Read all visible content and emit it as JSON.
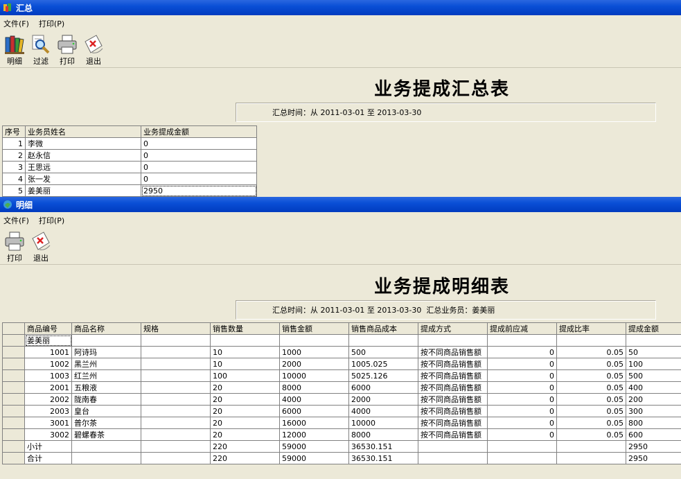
{
  "summary_window": {
    "title": "汇总",
    "menu": [
      "文件(F)",
      "打印(P)"
    ],
    "toolbar": [
      {
        "label": "明细",
        "icon": "books-icon"
      },
      {
        "label": "过滤",
        "icon": "filter-magnifier-icon"
      },
      {
        "label": "打印",
        "icon": "printer-icon"
      },
      {
        "label": "退出",
        "icon": "exit-icon"
      }
    ],
    "report_title": "业务提成汇总表",
    "info": "汇总时间：从 2011-03-01 至 2013-03-30",
    "table": {
      "headers": [
        "序号",
        "业务员姓名",
        "业务提成金额"
      ],
      "rows": [
        [
          "1",
          "李微",
          "0"
        ],
        [
          "2",
          "赵永信",
          "0"
        ],
        [
          "3",
          "王思远",
          "0"
        ],
        [
          "4",
          "张一发",
          "0"
        ],
        [
          "5",
          "姜美丽",
          "2950"
        ]
      ]
    }
  },
  "detail_window": {
    "title": "明细",
    "menu": [
      "文件(F)",
      "打印(P)"
    ],
    "toolbar": [
      {
        "label": "打印",
        "icon": "printer-icon"
      },
      {
        "label": "退出",
        "icon": "exit-icon"
      }
    ],
    "report_title": "业务提成明细表",
    "info": "汇总时间：从 2011-03-01 至 2013-03-30  汇总业务员：姜美丽",
    "table": {
      "headers": [
        "商品编号",
        "商品名称",
        "规格",
        "销售数量",
        "销售金额",
        "销售商品成本",
        "提成方式",
        "提成前应减",
        "提成比率",
        "提成金额"
      ],
      "group": "姜美丽",
      "rows": [
        [
          "1001",
          "阿诗玛",
          "",
          "10",
          "1000",
          "500",
          "按不同商品销售额",
          "0",
          "0.05",
          "50"
        ],
        [
          "1002",
          "黑兰州",
          "",
          "10",
          "2000",
          "1005.025",
          "按不同商品销售额",
          "0",
          "0.05",
          "100"
        ],
        [
          "1003",
          "红兰州",
          "",
          "100",
          "10000",
          "5025.126",
          "按不同商品销售额",
          "0",
          "0.05",
          "500"
        ],
        [
          "2001",
          "五粮液",
          "",
          "20",
          "8000",
          "6000",
          "按不同商品销售额",
          "0",
          "0.05",
          "400"
        ],
        [
          "2002",
          "陇南春",
          "",
          "20",
          "4000",
          "2000",
          "按不同商品销售额",
          "0",
          "0.05",
          "200"
        ],
        [
          "2003",
          "皇台",
          "",
          "20",
          "6000",
          "4000",
          "按不同商品销售额",
          "0",
          "0.05",
          "300"
        ],
        [
          "3001",
          "普尔茶",
          "",
          "20",
          "16000",
          "10000",
          "按不同商品销售额",
          "0",
          "0.05",
          "800"
        ],
        [
          "3002",
          "碧螺春茶",
          "",
          "20",
          "12000",
          "8000",
          "按不同商品销售额",
          "0",
          "0.05",
          "600"
        ]
      ],
      "totals": [
        [
          "小计",
          "",
          "",
          "220",
          "59000",
          "36530.151",
          "",
          "",
          "",
          "2950"
        ],
        [
          "合计",
          "",
          "",
          "220",
          "59000",
          "36530.151",
          "",
          "",
          "",
          "2950"
        ]
      ]
    }
  }
}
